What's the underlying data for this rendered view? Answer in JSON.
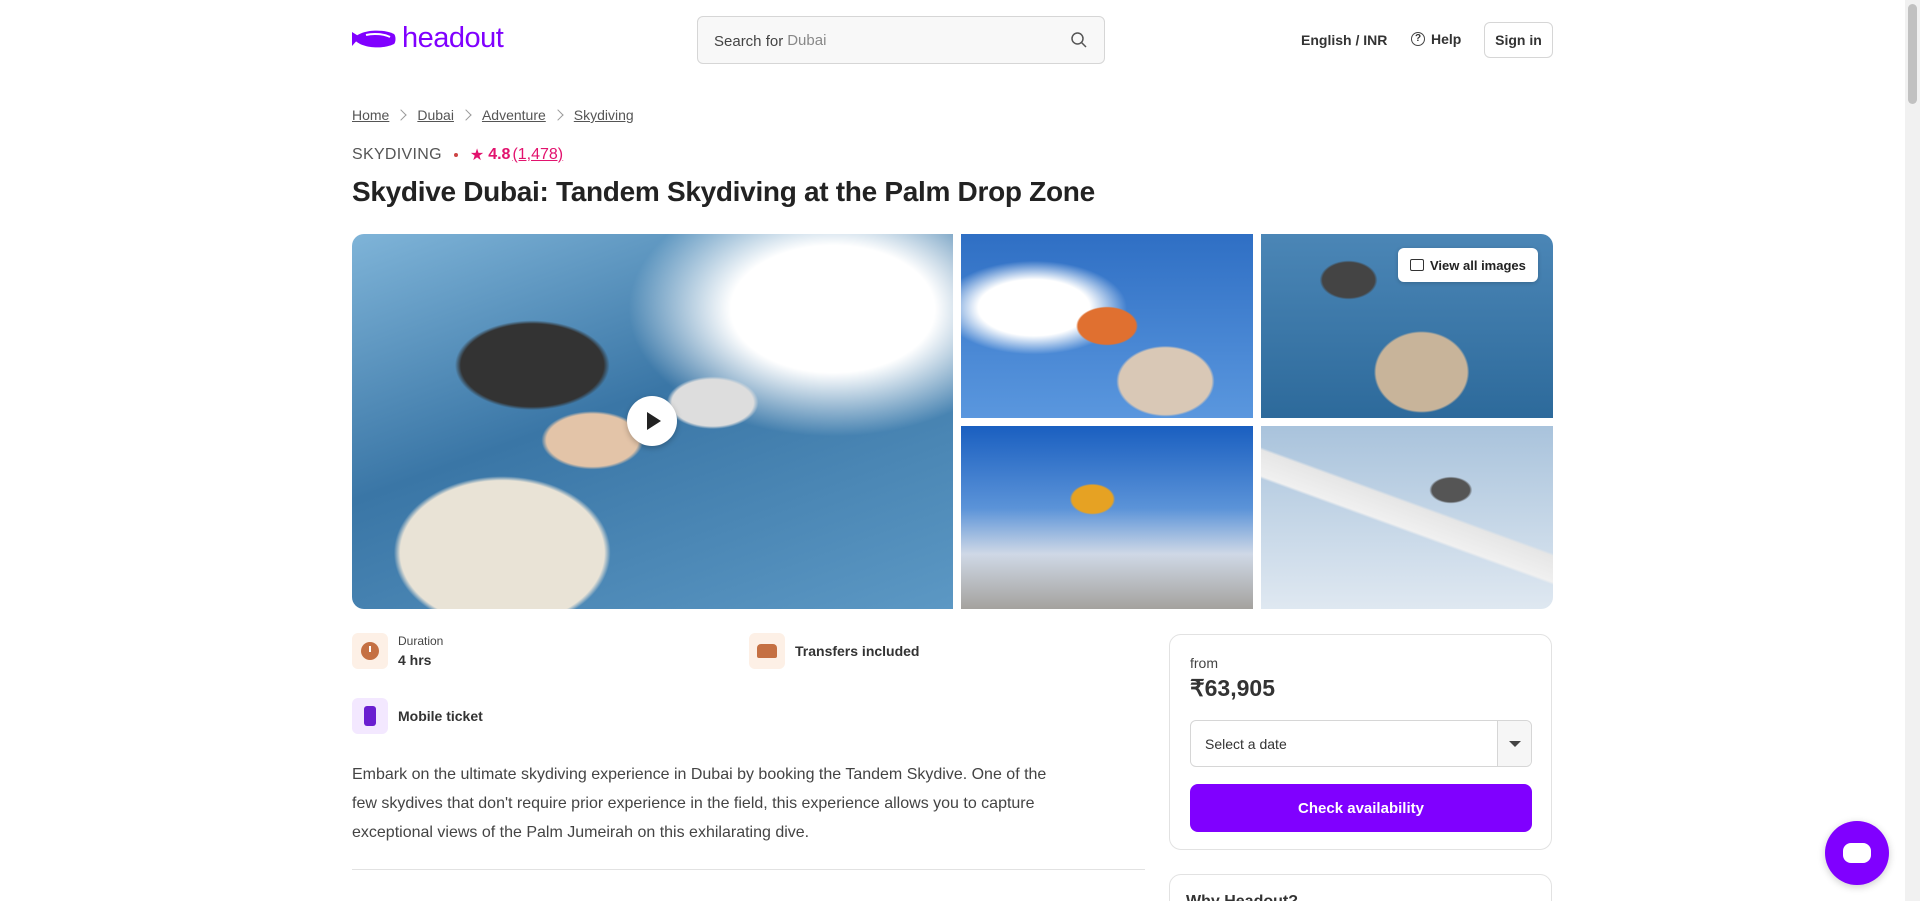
{
  "header": {
    "logo_text": "headout",
    "search_label": "Search for",
    "search_value": "Dubai",
    "language": "English / INR",
    "help": "Help",
    "sign_in": "Sign in"
  },
  "breadcrumb": [
    "Home",
    "Dubai",
    "Adventure",
    "Skydiving"
  ],
  "product": {
    "category": "SKYDIVING",
    "rating": "4.8",
    "reviews": "(1,478)",
    "title": "Skydive Dubai: Tandem Skydiving at the Palm Drop Zone"
  },
  "gallery": {
    "view_all": "View all images"
  },
  "features": {
    "duration_label": "Duration",
    "duration_value": "4 hrs",
    "transfers": "Transfers included",
    "mobile_ticket": "Mobile ticket"
  },
  "description": "Embark on the ultimate skydiving experience in Dubai by booking the Tandem Skydive. One of the few skydives that don't require prior experience in the field, this experience allows you to capture exceptional views of the Palm Jumeirah on this exhilarating dive.",
  "booking": {
    "from": "from",
    "price": "₹63,905",
    "date_placeholder": "Select a date",
    "cta": "Check availability"
  },
  "why_card": {
    "title": "Why Headout?"
  },
  "colors": {
    "brand": "#8000ff",
    "rating": "#e2136e"
  }
}
